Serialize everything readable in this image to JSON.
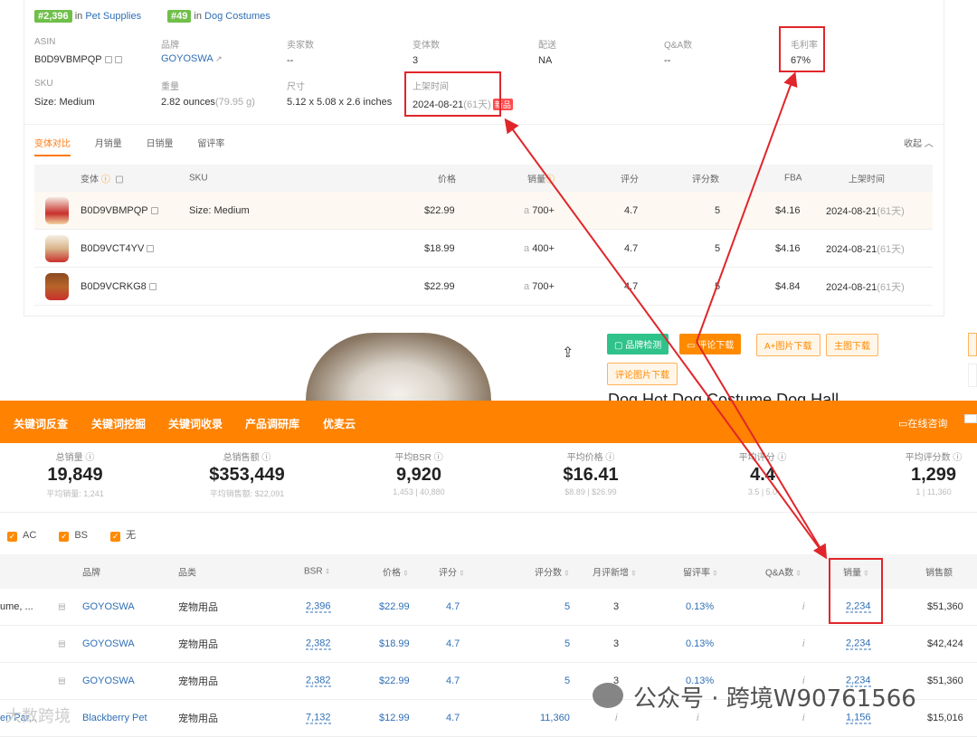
{
  "ranks": {
    "rank1": "#2,396",
    "in1": "in",
    "cat1": "Pet Supplies",
    "rank2": "#49",
    "in2": "in",
    "cat2": "Dog Costumes"
  },
  "info": {
    "asin_label": "ASIN",
    "asin": "B0D9VBMPQP",
    "brand_label": "品牌",
    "brand": "GOYOSWA",
    "sellers_label": "卖家数",
    "sellers": "--",
    "variants_label": "变体数",
    "variants": "3",
    "ship_label": "配送",
    "ship": "NA",
    "qa_label": "Q&A数",
    "qa": "--",
    "margin_label": "毛利率",
    "margin": "67%",
    "sku_label": "SKU",
    "sku": "Size: Medium",
    "weight_label": "重量",
    "weight": "2.82 ounces",
    "weight_g": "(79.95 g)",
    "size_label": "尺寸",
    "size": "5.12 x 5.08 x 2.6 inches",
    "listed_label": "上架时间",
    "listed": "2024-08-21",
    "listed_days": "(61天)",
    "new_tag": "新品"
  },
  "subtabs": {
    "t1": "变体对比",
    "t2": "月销量",
    "t3": "日销量",
    "t4": "留评率",
    "collapse": "收起"
  },
  "variant_headers": {
    "variant": "变体",
    "sku": "SKU",
    "price": "价格",
    "sales": "销量",
    "rating": "评分",
    "reviews": "评分数",
    "fba": "FBA",
    "listed": "上架时间"
  },
  "variants": [
    {
      "asin": "B0D9VBMPQP",
      "sku": "Size: Medium",
      "price": "$22.99",
      "sales": "700+",
      "rating": "4.7",
      "reviews": "5",
      "fba": "$4.16",
      "date": "2024-08-21",
      "days": "(61天)"
    },
    {
      "asin": "B0D9VCT4YV",
      "sku": "",
      "price": "$18.99",
      "sales": "400+",
      "rating": "4.7",
      "reviews": "5",
      "fba": "$4.16",
      "date": "2024-08-21",
      "days": "(61天)"
    },
    {
      "asin": "B0D9VCRKG8",
      "sku": "",
      "price": "$22.99",
      "sales": "700+",
      "rating": "4.7",
      "reviews": "5",
      "fba": "$4.84",
      "date": "2024-08-21",
      "days": "(61天)"
    }
  ],
  "actions": {
    "brand_check": "品牌检测",
    "review_dl": "评论下载",
    "aplus_dl": "A+图片下载",
    "main_dl": "主图下载",
    "review_img_dl": "评论图片下载",
    "product_title": "Dog Hot Dog Costume Dog Hall"
  },
  "menu": {
    "m1": "关键词反查",
    "m2": "关键词挖掘",
    "m3": "关键词收录",
    "m4": "产品调研库",
    "m5": "优麦云",
    "consult": "在线咨询"
  },
  "stats": [
    {
      "title": "总销量",
      "value": "19,849",
      "sub": "平均销量: 1,241"
    },
    {
      "title": "总销售额",
      "value": "$353,449",
      "sub": "平均销售额: $22,091"
    },
    {
      "title": "平均BSR",
      "value": "9,920",
      "sub": "1,453 | 40,880"
    },
    {
      "title": "平均价格",
      "value": "$16.41",
      "sub": "$8.89 | $26.99"
    },
    {
      "title": "平均评分",
      "value": "4.4",
      "sub": "3.5 | 5.0"
    },
    {
      "title": "平均评分数",
      "value": "1,299",
      "sub": "1 | 11,360"
    }
  ],
  "filters": {
    "f1": "AC",
    "f2": "BS",
    "f3": "无"
  },
  "bottom_headers": {
    "brand": "品牌",
    "category": "品类",
    "bsr": "BSR",
    "price": "价格",
    "rating": "评分",
    "reviews": "评分数",
    "monthly_new": "月评新增",
    "review_rate": "留评率",
    "qa": "Q&A数",
    "sales": "销量",
    "revenue": "销售额"
  },
  "bottom_rows": [
    {
      "title": "ume, ...",
      "brand": "GOYOSWA",
      "category": "宠物用品",
      "bsr": "2,396",
      "price": "$22.99",
      "rating": "4.7",
      "reviews": "5",
      "monthly_new": "3",
      "review_rate": "0.13%",
      "qa": "i",
      "sales": "2,234",
      "revenue": "$51,360"
    },
    {
      "title": "",
      "brand": "GOYOSWA",
      "category": "宠物用品",
      "bsr": "2,382",
      "price": "$18.99",
      "rating": "4.7",
      "reviews": "5",
      "monthly_new": "3",
      "review_rate": "0.13%",
      "qa": "i",
      "sales": "2,234",
      "revenue": "$42,424"
    },
    {
      "title": "",
      "brand": "GOYOSWA",
      "category": "宠物用品",
      "bsr": "2,382",
      "price": "$22.99",
      "rating": "4.7",
      "reviews": "5",
      "monthly_new": "3",
      "review_rate": "0.13%",
      "qa": "i",
      "sales": "2,234",
      "revenue": "$51,360"
    },
    {
      "title": "en Par...",
      "brand": "Blackberry Pet",
      "category": "宠物用品",
      "bsr": "7,132",
      "price": "$12.99",
      "rating": "4.7",
      "reviews": "11,360",
      "monthly_new": "i",
      "review_rate": "i",
      "qa": "i",
      "sales": "1,156",
      "revenue": "$15,016"
    }
  ],
  "watermark": {
    "text": "公众号 · 跨境W90761566",
    "left": "大数跨境"
  },
  "colors": {
    "orange": "#ff8200",
    "red_annotation": "#e0262b",
    "link_blue": "#2f6fb5",
    "badge_green": "#6fbf4a"
  }
}
